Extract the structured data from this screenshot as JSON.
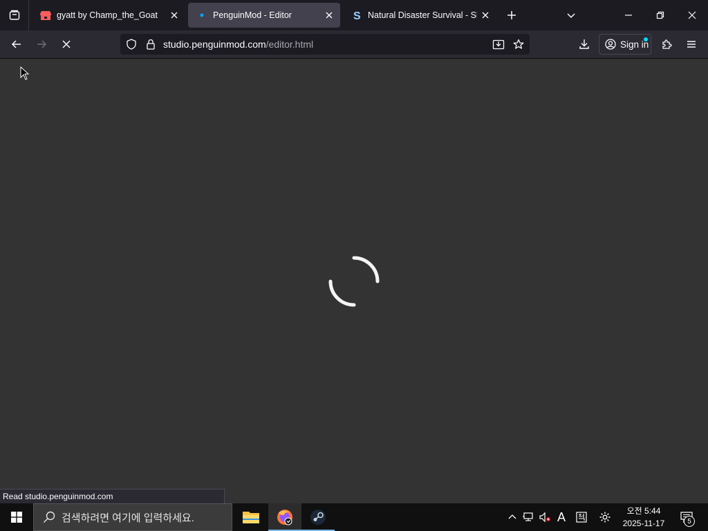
{
  "browser": {
    "tabs": [
      {
        "title": "gyatt by Champ_the_Goat",
        "favicon": "itch-icon",
        "active": false
      },
      {
        "title": "PenguinMod - Editor",
        "favicon": "loading-dot-icon",
        "active": true
      },
      {
        "title": "Natural Disaster Survival - Shk",
        "favicon": "s-logo-icon",
        "active": false
      }
    ],
    "url": {
      "host": "studio.penguinmod.com",
      "path": "/editor.html"
    },
    "signin_label": "Sign in",
    "status_text": "Read studio.penguinmod.com"
  },
  "colors": {
    "accent": "#00ddff",
    "content_bg": "#333333",
    "tab_active": "#42414d"
  },
  "taskbar": {
    "search_placeholder": "검색하려면 여기에 입력하세요.",
    "clock_time": "오전 5:44",
    "clock_date": "2025-11-17",
    "ime_label": "A",
    "notification_count": "5",
    "apps": [
      "file-explorer-icon",
      "firefox-icon",
      "steam-icon"
    ]
  }
}
